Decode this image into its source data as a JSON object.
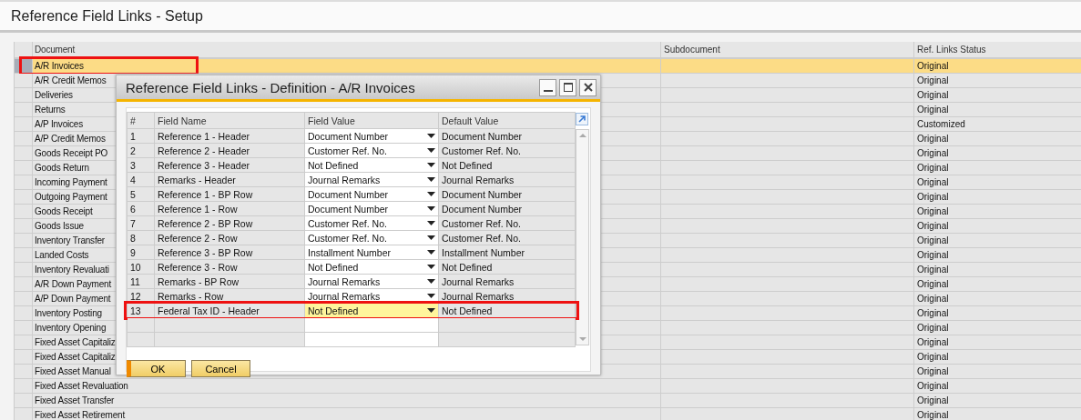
{
  "window": {
    "title": "Reference Field Links - Setup"
  },
  "table": {
    "columns": [
      "Document",
      "Subdocument",
      "Ref. Links Status"
    ],
    "rows": [
      {
        "document": "A/R Invoices",
        "subdocument": "",
        "status": "Original",
        "selected": true,
        "highlighted": true
      },
      {
        "document": "A/R Credit Memos",
        "subdocument": "",
        "status": "Original",
        "selected": false,
        "highlighted": false
      },
      {
        "document": "Deliveries",
        "subdocument": "",
        "status": "Original",
        "selected": false,
        "highlighted": false
      },
      {
        "document": "Returns",
        "subdocument": "",
        "status": "Original",
        "selected": false,
        "highlighted": false
      },
      {
        "document": "A/P Invoices",
        "subdocument": "",
        "status": "Customized",
        "selected": false,
        "highlighted": false
      },
      {
        "document": "A/P Credit Memos",
        "subdocument": "",
        "status": "Original",
        "selected": false,
        "highlighted": false
      },
      {
        "document": "Goods Receipt PO",
        "subdocument": "",
        "status": "Original",
        "selected": false,
        "highlighted": false
      },
      {
        "document": "Goods Return",
        "subdocument": "",
        "status": "Original",
        "selected": false,
        "highlighted": false
      },
      {
        "document": "Incoming Payment",
        "subdocument": "",
        "status": "Original",
        "selected": false,
        "highlighted": false
      },
      {
        "document": "Outgoing Payment",
        "subdocument": "",
        "status": "Original",
        "selected": false,
        "highlighted": false
      },
      {
        "document": "Goods Receipt",
        "subdocument": "",
        "status": "Original",
        "selected": false,
        "highlighted": false
      },
      {
        "document": "Goods Issue",
        "subdocument": "",
        "status": "Original",
        "selected": false,
        "highlighted": false
      },
      {
        "document": "Inventory Transfer",
        "subdocument": "",
        "status": "Original",
        "selected": false,
        "highlighted": false
      },
      {
        "document": "Landed Costs",
        "subdocument": "",
        "status": "Original",
        "selected": false,
        "highlighted": false
      },
      {
        "document": "Inventory Revaluati",
        "subdocument": "",
        "status": "Original",
        "selected": false,
        "highlighted": false
      },
      {
        "document": "A/R Down Payment",
        "subdocument": "",
        "status": "Original",
        "selected": false,
        "highlighted": false
      },
      {
        "document": "A/P Down Payment",
        "subdocument": "",
        "status": "Original",
        "selected": false,
        "highlighted": false
      },
      {
        "document": "Inventory Posting",
        "subdocument": "",
        "status": "Original",
        "selected": false,
        "highlighted": false
      },
      {
        "document": "Inventory Opening",
        "subdocument": "",
        "status": "Original",
        "selected": false,
        "highlighted": false
      },
      {
        "document": "Fixed Asset Capitaliz",
        "subdocument": "",
        "status": "Original",
        "selected": false,
        "highlighted": false
      },
      {
        "document": "Fixed Asset Capitaliz",
        "subdocument": "",
        "status": "Original",
        "selected": false,
        "highlighted": false
      },
      {
        "document": "Fixed Asset Manual",
        "subdocument": "",
        "status": "Original",
        "selected": false,
        "highlighted": false
      },
      {
        "document": "Fixed Asset Revaluation",
        "subdocument": "",
        "status": "Original",
        "selected": false,
        "highlighted": false
      },
      {
        "document": "Fixed Asset Transfer",
        "subdocument": "",
        "status": "Original",
        "selected": false,
        "highlighted": false
      },
      {
        "document": "Fixed Asset Retirement",
        "subdocument": "",
        "status": "Original",
        "selected": false,
        "highlighted": false
      }
    ]
  },
  "dialog": {
    "title": "Reference Field Links - Definition - A/R Invoices",
    "columns": [
      "#",
      "Field Name",
      "Field Value",
      "Default Value"
    ],
    "rows": [
      {
        "number": "1",
        "field_name": "Reference 1 - Header",
        "field_value": "Document Number",
        "default_value": "Document Number",
        "selected": false,
        "highlighted": false
      },
      {
        "number": "2",
        "field_name": "Reference 2 - Header",
        "field_value": "Customer Ref. No.",
        "default_value": "Customer Ref. No.",
        "selected": false,
        "highlighted": false
      },
      {
        "number": "3",
        "field_name": "Reference 3 - Header",
        "field_value": "Not Defined",
        "default_value": "Not Defined",
        "selected": false,
        "highlighted": false
      },
      {
        "number": "4",
        "field_name": "Remarks - Header",
        "field_value": "Journal Remarks",
        "default_value": "Journal Remarks",
        "selected": false,
        "highlighted": false
      },
      {
        "number": "5",
        "field_name": "Reference 1 - BP Row",
        "field_value": "Document Number",
        "default_value": "Document Number",
        "selected": false,
        "highlighted": false
      },
      {
        "number": "6",
        "field_name": "Reference 1 - Row",
        "field_value": "Document Number",
        "default_value": "Document Number",
        "selected": false,
        "highlighted": false
      },
      {
        "number": "7",
        "field_name": "Reference 2 - BP Row",
        "field_value": "Customer Ref. No.",
        "default_value": "Customer Ref. No.",
        "selected": false,
        "highlighted": false
      },
      {
        "number": "8",
        "field_name": "Reference 2 - Row",
        "field_value": "Customer Ref. No.",
        "default_value": "Customer Ref. No.",
        "selected": false,
        "highlighted": false
      },
      {
        "number": "9",
        "field_name": "Reference 3 - BP Row",
        "field_value": "Installment Number",
        "default_value": "Installment Number",
        "selected": false,
        "highlighted": false
      },
      {
        "number": "10",
        "field_name": "Reference 3 - Row",
        "field_value": "Not Defined",
        "default_value": "Not Defined",
        "selected": false,
        "highlighted": false
      },
      {
        "number": "11",
        "field_name": "Remarks - BP Row",
        "field_value": "Journal Remarks",
        "default_value": "Journal Remarks",
        "selected": false,
        "highlighted": false
      },
      {
        "number": "12",
        "field_name": "Remarks - Row",
        "field_value": "Journal Remarks",
        "default_value": "Journal Remarks",
        "selected": false,
        "highlighted": false
      },
      {
        "number": "13",
        "field_name": "Federal Tax ID - Header",
        "field_value": "Not Defined",
        "default_value": "Not Defined",
        "selected": true,
        "highlighted": true
      }
    ],
    "buttons": [
      "OK",
      "Cancel"
    ]
  }
}
